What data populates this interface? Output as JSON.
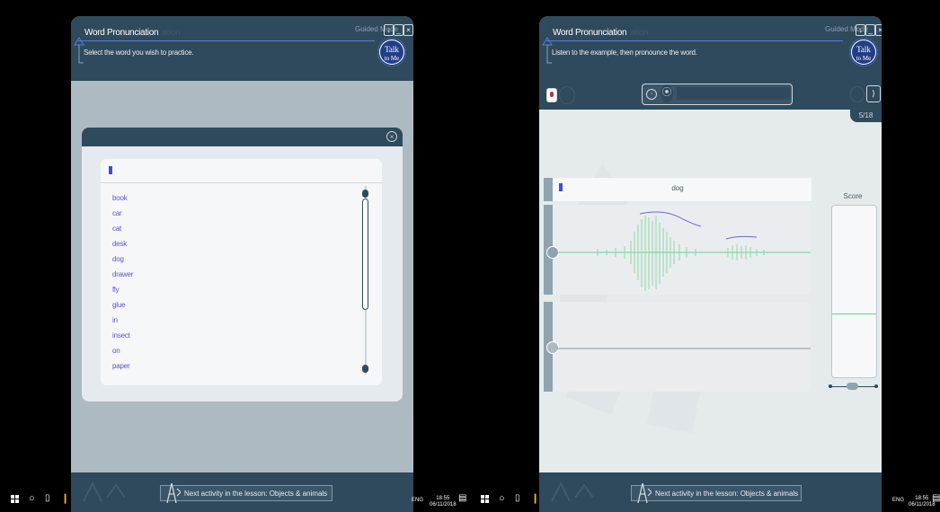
{
  "left_window": {
    "title": "Word Pronunciation",
    "title_ghost": "ation",
    "mode_label": "Guided Mode",
    "instruction": "Select the word you wish to practice.",
    "logo_line1": "Talk",
    "logo_line2": "to Me",
    "word_list": [
      "book",
      "car",
      "cat",
      "desk",
      "dog",
      "drawer",
      "fly",
      "glue",
      "in",
      "insect",
      "on",
      "paper"
    ],
    "next_activity": "Next activity in the lesson: Objects & animals"
  },
  "right_window": {
    "title": "Word Pronunciation",
    "title_ghost": "ation",
    "mode_label": "Guided Mode",
    "instruction": "Listen to the example, then pronounce the word.",
    "logo_line1": "Talk",
    "logo_line2": "to Me",
    "progress": "5/18",
    "current_word": "dog",
    "score_label": "Score",
    "next_activity": "Next activity in the lesson: Objects & animals"
  },
  "taskbar_left": {
    "lang": "ENG",
    "time": "18:55",
    "date": "06/11/2018"
  },
  "taskbar_right": {
    "lang": "ENG",
    "time": "18:55",
    "date": "06/11/2018"
  },
  "colors": {
    "header": "#2f4a5c",
    "accent": "#5a52e0",
    "wave": "#8ed6a6",
    "pitch": "#6d6ad8"
  }
}
